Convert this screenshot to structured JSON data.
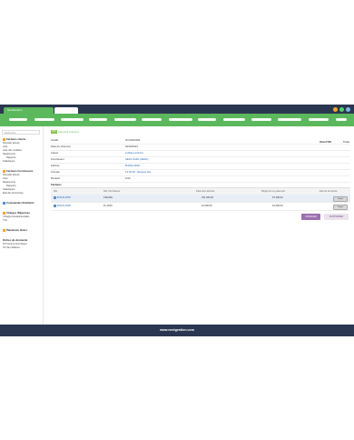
{
  "app": {
    "brand": "NextGestion"
  },
  "window_controls": {
    "colors": [
      "#f5a623",
      "#4cd964",
      "#7fb3e6"
    ]
  },
  "sidebar": {
    "search_placeholder": "Recherche",
    "sections": [
      {
        "title": "Factures clients",
        "color": "#f5a623",
        "items": [
          "Nouvelle facture",
          "Liste",
          "Liste des modèles",
          "Règlements",
          "Rapports",
          "Statistiques"
        ]
      },
      {
        "title": "Factures fournisseurs",
        "color": "#f5a623",
        "items": [
          "Nouvelle facture",
          "Liste",
          "Règlements",
          "Rapports",
          "Statistiques",
          "Etat des tiers/mises"
        ]
      },
      {
        "title": "Commandes fin/clients",
        "color": "#4a90d9",
        "items": []
      },
      {
        "title": "Charges /Dépenses",
        "color": "#f5a623",
        "items": [
          "Charges fiscales/sociales",
          "TVA"
        ]
      },
      {
        "title": "Paiements divers",
        "color": "#f5a623",
        "items": []
      },
      {
        "title": "Ordres de virements",
        "color": "",
        "items": [
          "OV Facture fournisseur",
          "OV des Salaires"
        ]
      }
    ]
  },
  "main": {
    "badge": "FAF",
    "back_link": "Liste des virement",
    "status": {
      "label": "Etat d'OK",
      "value": "Traité"
    },
    "details": [
      {
        "label": "Libellé",
        "value": "OV/010/2021"
      },
      {
        "label": "Date de Virement",
        "value": "02/02/2021"
      },
      {
        "label": "Auteur",
        "value": "Lollipop ambrus"
      },
      {
        "label": "Fournisseur",
        "value": "SEKA SARL (SEKA)"
      },
      {
        "label": "Facture",
        "value": "B/1912-0002"
      },
      {
        "label": "Compte",
        "value": "13.00.00 - Banque ddy"
      },
      {
        "label": "Montant",
        "value": "0.00"
      }
    ],
    "invoices": {
      "title": "Factures",
      "headers": [
        "Ref",
        "Ref. fournisseur",
        "Paiement attendu",
        "Réglé par ce paiement",
        "Etat de la facture"
      ],
      "rows": [
        {
          "ref": "B/1912-0002",
          "supplier_ref": "FSHARL",
          "expected": "331 460.00",
          "paid": "97 400.00",
          "action": "Payée"
        },
        {
          "ref": "B/2101-0006",
          "supplier_ref": "FL-2016",
          "expected": "10 000.00",
          "paid": "10 000.00",
          "action": "Payée"
        }
      ]
    },
    "buttons": {
      "cancel": "ANNULER",
      "delete": "SUPPRIMER"
    }
  },
  "footer": {
    "text": "www.nextgestion.com"
  }
}
